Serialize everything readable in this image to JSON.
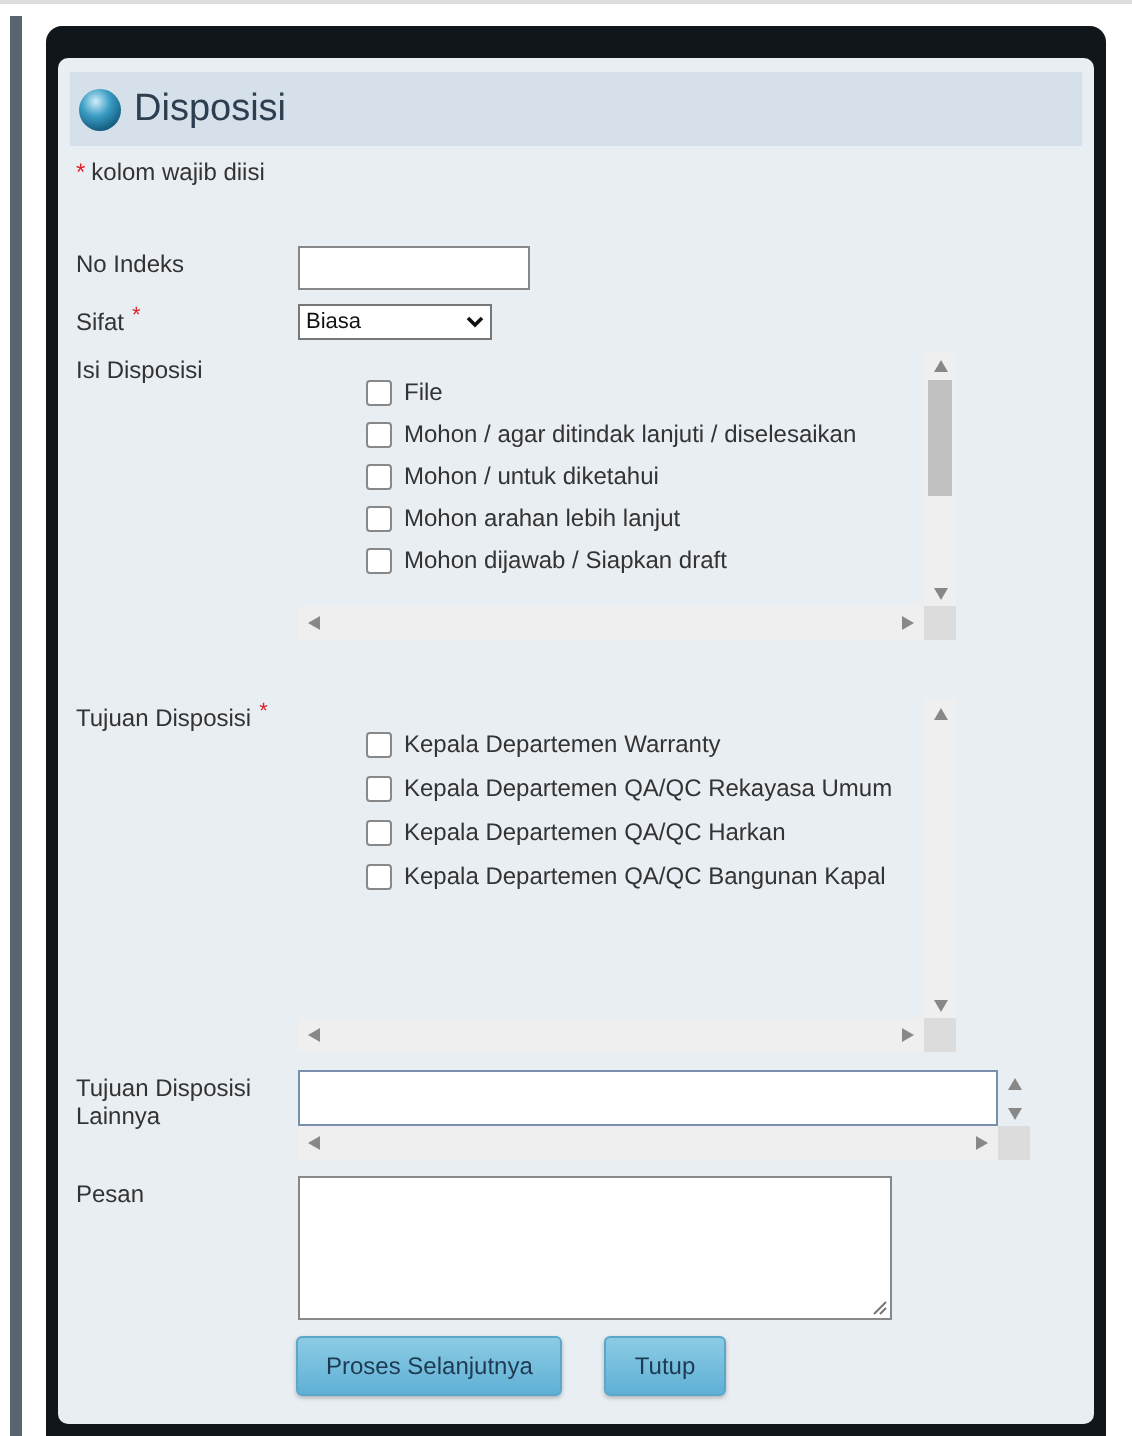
{
  "dialog": {
    "title": "Disposisi",
    "required_note": {
      "marker": "*",
      "text": "kolom wajib diisi"
    }
  },
  "fields": [
    {
      "kind": "text",
      "label": "No Indeks"
    },
    {
      "kind": "select",
      "label": "Sifat",
      "required_marker": "*",
      "value": "Biasa"
    },
    {
      "kind": "checklist",
      "label": "Isi Disposisi",
      "items": [
        {
          "label": "File",
          "checked": false
        },
        {
          "label": "Mohon / agar ditindak lanjuti / diselesaikan",
          "checked": false
        },
        {
          "label": "Mohon / untuk diketahui",
          "checked": false
        },
        {
          "label": "Mohon arahan lebih lanjut",
          "checked": false
        },
        {
          "label": "Mohon dijawab / Siapkan draft",
          "checked": false
        }
      ]
    },
    {
      "kind": "checklist",
      "label": "Tujuan Disposisi",
      "required_marker": "*",
      "items": [
        {
          "label": "Kepala Departemen Warranty",
          "checked": false
        },
        {
          "label": "Kepala Departemen QA/QC Rekayasa Umum",
          "checked": false
        },
        {
          "label": "Kepala Departemen QA/QC Harkan",
          "checked": false
        },
        {
          "label": "Kepala Departemen QA/QC Bangunan Kapal",
          "checked": false
        }
      ]
    },
    {
      "kind": "scrolltext",
      "label": "Tujuan Disposisi Lainnya"
    },
    {
      "kind": "textarea",
      "label": "Pesan"
    }
  ],
  "buttons": [
    "Proses Selanjutnya",
    "Tutup"
  ]
}
